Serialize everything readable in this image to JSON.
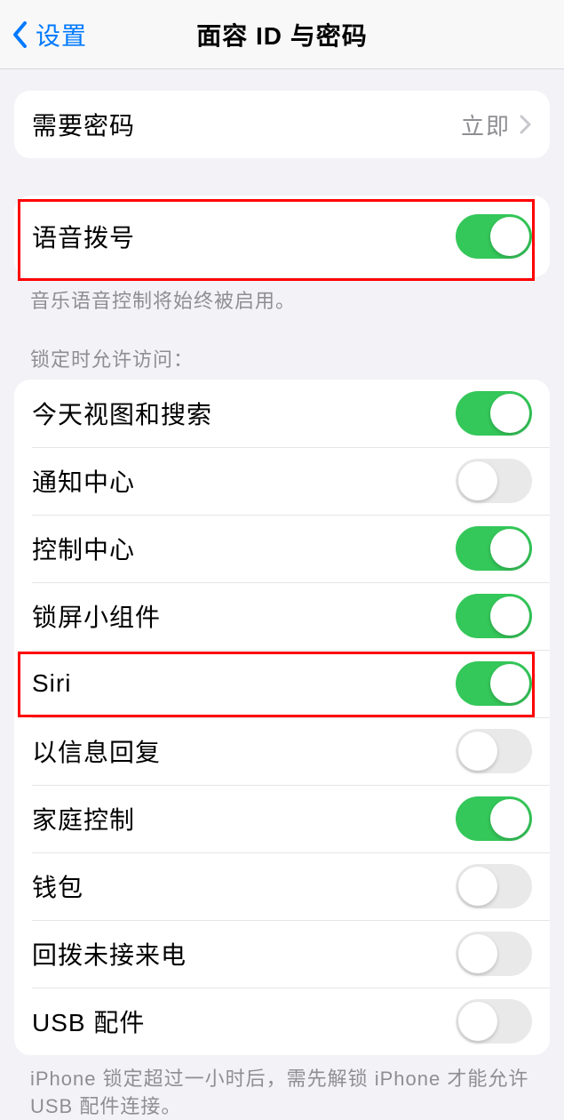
{
  "nav": {
    "back_label": "设置",
    "title": "面容 ID 与密码"
  },
  "require_passcode": {
    "label": "需要密码",
    "value": "立即"
  },
  "voice_dial": {
    "label": "语音拨号",
    "on": true
  },
  "voice_dial_caption": "音乐语音控制将始终被启用。",
  "locked_access_header": "锁定时允许访问：",
  "locked_items": [
    {
      "label": "今天视图和搜索",
      "on": true
    },
    {
      "label": "通知中心",
      "on": false
    },
    {
      "label": "控制中心",
      "on": true
    },
    {
      "label": "锁屏小组件",
      "on": true
    },
    {
      "label": "Siri",
      "on": true
    },
    {
      "label": "以信息回复",
      "on": false
    },
    {
      "label": "家庭控制",
      "on": true
    },
    {
      "label": "钱包",
      "on": false
    },
    {
      "label": "回拨未接来电",
      "on": false
    },
    {
      "label": "USB 配件",
      "on": false
    }
  ],
  "usb_caption": "iPhone 锁定超过一小时后，需先解锁 iPhone 才能允许 USB 配件连接。"
}
